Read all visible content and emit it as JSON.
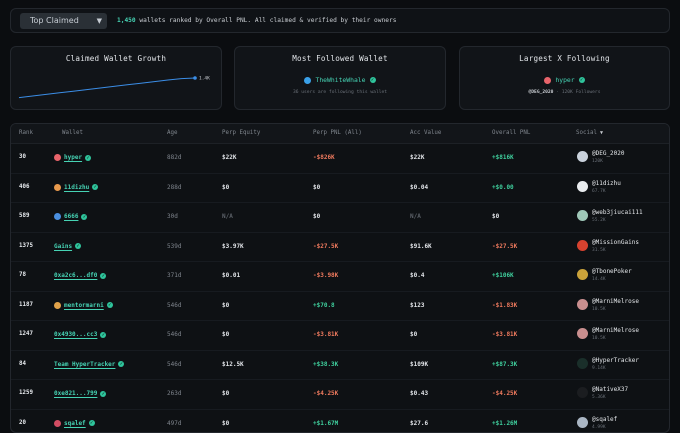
{
  "topbar": {
    "filter_label": "Top Claimed",
    "count": "1,450",
    "summary_text": "wallets ranked by Overall PNL. All claimed & verified by their owners"
  },
  "cards": {
    "growth": {
      "title": "Claimed Wallet Growth",
      "end_label": "1.4K"
    },
    "followed": {
      "title": "Most Followed Wallet",
      "name": "TheWhiteWhale",
      "sub": "36 users are following this wallet"
    },
    "largest": {
      "title": "Largest X Following",
      "name": "hyper",
      "handle": "@DEG_2020",
      "followers": "· 120K Followers"
    }
  },
  "growth_chart": {
    "type": "line",
    "series": [
      {
        "values": [
          0.02,
          0.1,
          0.18,
          0.26,
          0.34,
          0.42,
          0.5,
          0.58,
          0.66,
          0.74,
          0.82,
          0.9,
          0.97,
          1.0
        ]
      }
    ],
    "end_value_label": "1.4K"
  },
  "table": {
    "headers": {
      "rank": "Rank",
      "wallet": "Wallet",
      "age": "Age",
      "equity": "Perp Equity",
      "pnl": "Perp PNL (All)",
      "acc": "Acc Value",
      "overall": "Overall PNL",
      "social": "Social"
    },
    "rows": [
      {
        "rank": "30",
        "wallet": "hyper",
        "icon_color": "#e8646b",
        "age": "882d",
        "equity": "$22K",
        "pnl": "-$826K",
        "pnl_sign": "neg",
        "acc": "$22K",
        "overall": "+$816K",
        "overall_sign": "pos",
        "handle": "@DEG_2020",
        "followers": "120K",
        "avatar": "#c9d2dc"
      },
      {
        "rank": "406",
        "wallet": "11dizhu",
        "icon_color": "#e89a4d",
        "age": "288d",
        "equity": "$0",
        "pnl": "$0",
        "pnl_sign": "plain",
        "acc": "$0.04",
        "overall": "+$0.00",
        "overall_sign": "pos",
        "handle": "@11dizhu",
        "followers": "67.7K",
        "avatar": "#e9ecef"
      },
      {
        "rank": "589",
        "wallet": "6666",
        "icon_color": "#4a8fe0",
        "age": "30d",
        "equity": "N/A",
        "pnl": "$0",
        "pnl_sign": "plain",
        "acc": "N/A",
        "overall": "$0",
        "overall_sign": "plain",
        "handle": "@web3jiucai111",
        "followers": "55.2K",
        "avatar": "#9fc8b8"
      },
      {
        "rank": "1375",
        "wallet": "Gains",
        "icon_color": "",
        "age": "539d",
        "equity": "$3.97K",
        "pnl": "-$27.5K",
        "pnl_sign": "neg",
        "acc": "$91.6K",
        "overall": "-$27.5K",
        "overall_sign": "neg",
        "handle": "@MissionGains",
        "followers": "31.5K",
        "avatar": "#d6422f"
      },
      {
        "rank": "78",
        "wallet": "0xa2c6...df0",
        "icon_color": "",
        "age": "371d",
        "equity": "$0.01",
        "pnl": "-$3.98K",
        "pnl_sign": "neg",
        "acc": "$0.4",
        "overall": "+$106K",
        "overall_sign": "pos",
        "handle": "@TbonePoker",
        "followers": "14.4K",
        "avatar": "#caa23a"
      },
      {
        "rank": "1187",
        "wallet": "mentormarni",
        "icon_color": "#e0a24a",
        "age": "546d",
        "equity": "$0",
        "pnl": "+$70.8",
        "pnl_sign": "pos",
        "acc": "$123",
        "overall": "-$1.83K",
        "overall_sign": "neg",
        "handle": "@MarniMelrose",
        "followers": "10.5K",
        "avatar": "#c98f8f"
      },
      {
        "rank": "1247",
        "wallet": "0x4930...cc3",
        "icon_color": "",
        "age": "546d",
        "equity": "$0",
        "pnl": "-$3.81K",
        "pnl_sign": "neg",
        "acc": "$0",
        "overall": "-$3.81K",
        "overall_sign": "neg",
        "handle": "@MarniMelrose",
        "followers": "10.5K",
        "avatar": "#c98f8f"
      },
      {
        "rank": "84",
        "wallet": "Team HyperTracker",
        "icon_color": "",
        "age": "546d",
        "equity": "$12.5K",
        "pnl": "+$38.3K",
        "pnl_sign": "pos",
        "acc": "$109K",
        "overall": "+$87.3K",
        "overall_sign": "pos",
        "handle": "@HyperTracker",
        "followers": "9.14K",
        "avatar": "#1a2f2a"
      },
      {
        "rank": "1259",
        "wallet": "0xe821...799",
        "icon_color": "",
        "age": "263d",
        "equity": "$0",
        "pnl": "-$4.25K",
        "pnl_sign": "neg",
        "acc": "$0.43",
        "overall": "-$4.25K",
        "overall_sign": "neg",
        "handle": "@NativeX37",
        "followers": "5.36K",
        "avatar": "#1b1d20"
      },
      {
        "rank": "20",
        "wallet": "sqalef",
        "icon_color": "#d24d63",
        "age": "497d",
        "equity": "$0",
        "pnl": "+$1.67M",
        "pnl_sign": "pos",
        "acc": "$27.6",
        "overall": "+$1.26M",
        "overall_sign": "pos",
        "handle": "@sqalef",
        "followers": "4.99K",
        "avatar": "#aab6c4"
      }
    ]
  }
}
